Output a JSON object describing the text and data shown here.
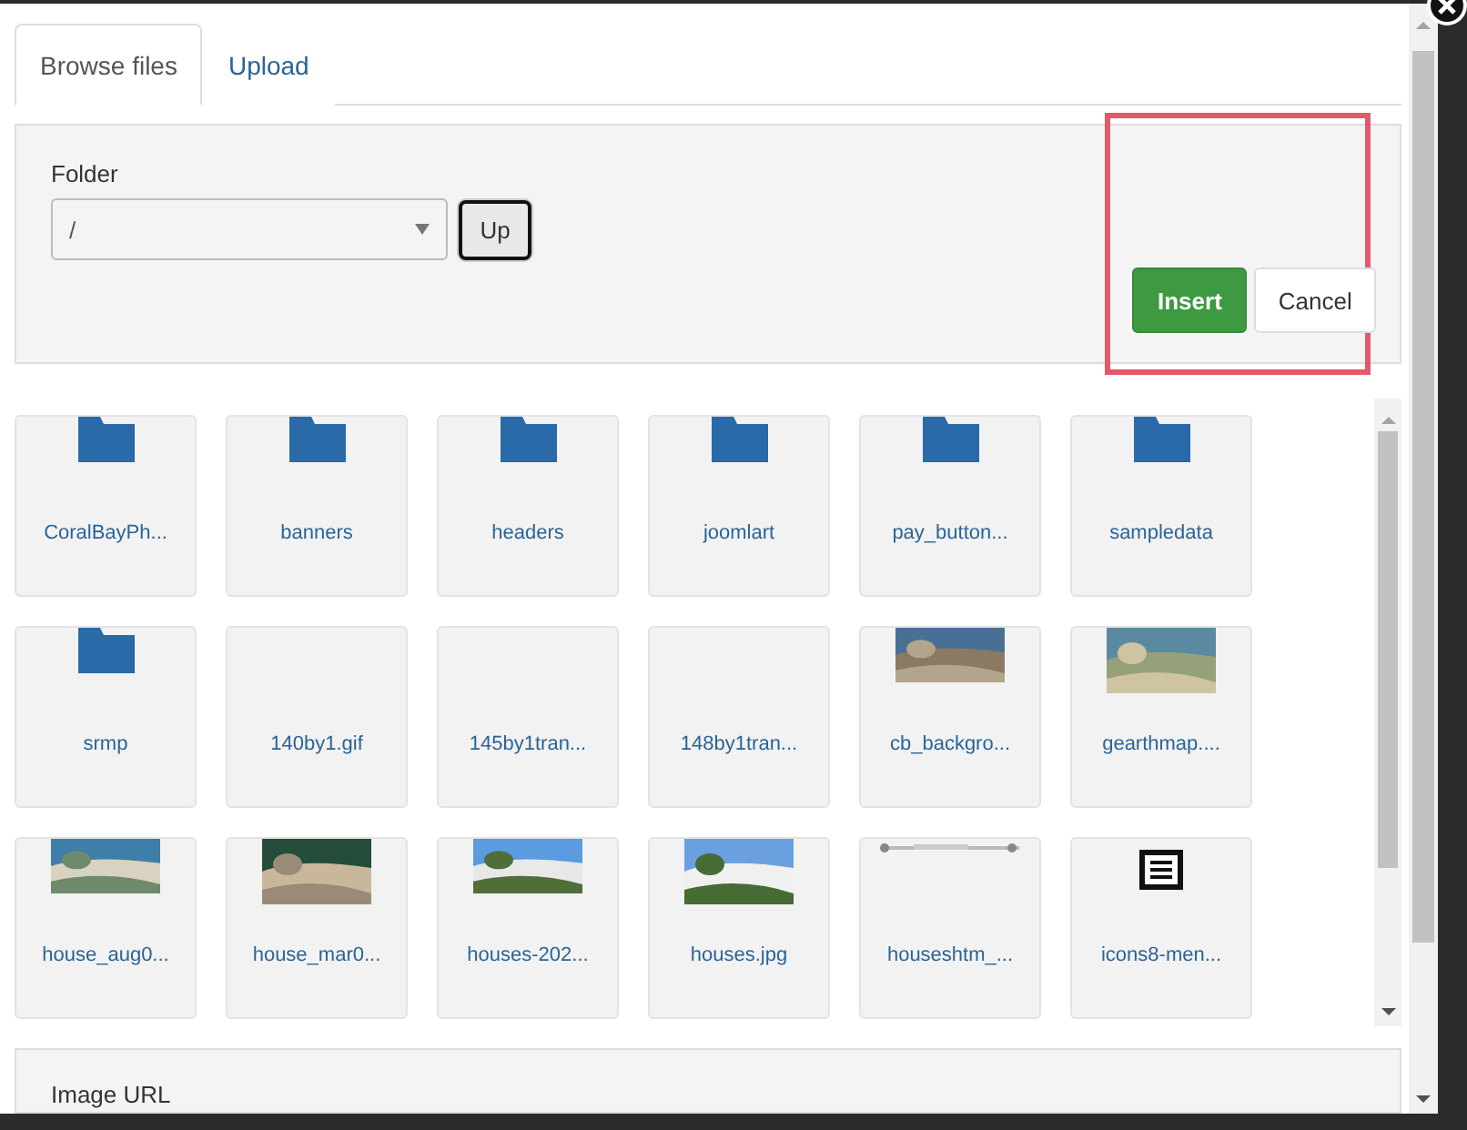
{
  "tabs": [
    {
      "label": "Browse files",
      "selected": true
    },
    {
      "label": "Upload",
      "selected": false
    }
  ],
  "folder": {
    "label": "Folder",
    "value": "/",
    "up_button": "Up"
  },
  "actions": {
    "insert": "Insert",
    "cancel": "Cancel"
  },
  "files": [
    {
      "name": "CoralBayPh...",
      "kind": "folder"
    },
    {
      "name": "banners",
      "kind": "folder"
    },
    {
      "name": "headers",
      "kind": "folder"
    },
    {
      "name": "joomlart",
      "kind": "folder"
    },
    {
      "name": "pay_button...",
      "kind": "folder"
    },
    {
      "name": "sampledata",
      "kind": "folder"
    },
    {
      "name": "srmp",
      "kind": "folder"
    },
    {
      "name": "140by1.gif",
      "kind": "blank"
    },
    {
      "name": "145by1tran...",
      "kind": "blank"
    },
    {
      "name": "148by1tran...",
      "kind": "blank"
    },
    {
      "name": "cb_backgro...",
      "kind": "picture"
    },
    {
      "name": "gearthmap....",
      "kind": "picture"
    },
    {
      "name": "house_aug0...",
      "kind": "picture"
    },
    {
      "name": "house_mar0...",
      "kind": "picture"
    },
    {
      "name": "houses-202...",
      "kind": "picture"
    },
    {
      "name": "houses.jpg",
      "kind": "picture"
    },
    {
      "name": "houseshtm_...",
      "kind": "strip"
    },
    {
      "name": "icons8-men...",
      "kind": "document"
    }
  ],
  "image_url": {
    "label": "Image URL"
  }
}
